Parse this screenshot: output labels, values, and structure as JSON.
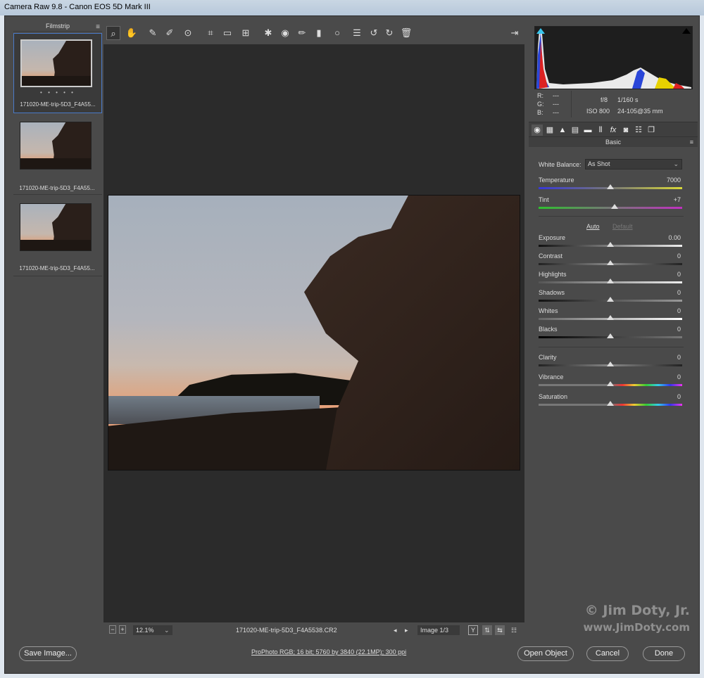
{
  "window": {
    "title": "Camera Raw 9.8  -  Canon EOS 5D Mark III"
  },
  "filmstrip": {
    "title": "Filmstrip",
    "menu_icon": "menu-icon",
    "items": [
      {
        "name": "171020-ME-trip-5D3_F4A55...",
        "stars": "• • • • •",
        "selected": true
      },
      {
        "name": "171020-ME-trip-5D3_F4A55...",
        "selected": false
      },
      {
        "name": "171020-ME-trip-5D3_F4A55...",
        "selected": false
      }
    ]
  },
  "toolbar": {
    "tools": [
      "zoom-icon",
      "hand-icon",
      "white-balance-icon",
      "color-sampler-icon",
      "targeted-adjustment-icon",
      "crop-icon",
      "straighten-icon",
      "transform-icon",
      "spot-removal-icon",
      "red-eye-icon",
      "adjustment-brush-icon",
      "graduated-filter-icon",
      "radial-filter-icon",
      "preferences-icon",
      "rotate-left-icon",
      "rotate-right-icon",
      "trash-icon"
    ],
    "fullscreen_icon": "fullscreen-icon"
  },
  "bottom_bar": {
    "zoom": "12.1%",
    "filename": "171020-ME-trip-5D3_F4A5538.CR2",
    "image_counter": "Image 1/3",
    "y_button": "Y"
  },
  "info": {
    "r_label": "R:",
    "r_value": "---",
    "g_label": "G:",
    "g_value": "---",
    "b_label": "B:",
    "b_value": "---",
    "aperture": "f/8",
    "shutter": "1/160 s",
    "iso": "ISO 800",
    "lens": "24-105@35 mm"
  },
  "panel": {
    "section_title": "Basic",
    "white_balance_label": "White Balance:",
    "white_balance_value": "As Shot",
    "auto_label": "Auto",
    "default_label": "Default",
    "sliders": [
      {
        "label": "Temperature",
        "value": "7000",
        "position": 0.5
      },
      {
        "label": "Tint",
        "value": "+7",
        "position": 0.53
      },
      {
        "label": "Exposure",
        "value": "0.00",
        "position": 0.5
      },
      {
        "label": "Contrast",
        "value": "0",
        "position": 0.5
      },
      {
        "label": "Highlights",
        "value": "0",
        "position": 0.5
      },
      {
        "label": "Shadows",
        "value": "0",
        "position": 0.5
      },
      {
        "label": "Whites",
        "value": "0",
        "position": 0.5
      },
      {
        "label": "Blacks",
        "value": "0",
        "position": 0.5
      },
      {
        "label": "Clarity",
        "value": "0",
        "position": 0.5
      },
      {
        "label": "Vibrance",
        "value": "0",
        "position": 0.5
      },
      {
        "label": "Saturation",
        "value": "0",
        "position": 0.5
      }
    ]
  },
  "footer": {
    "save_label": "Save Image...",
    "workflow_info": "ProPhoto RGB; 16 bit; 5760 by 3840 (22.1MP); 300 ppi",
    "open_label": "Open Object",
    "cancel_label": "Cancel",
    "done_label": "Done"
  },
  "watermark": {
    "line1": "© Jim Doty, Jr.",
    "line2": "www.JimDoty.com"
  }
}
